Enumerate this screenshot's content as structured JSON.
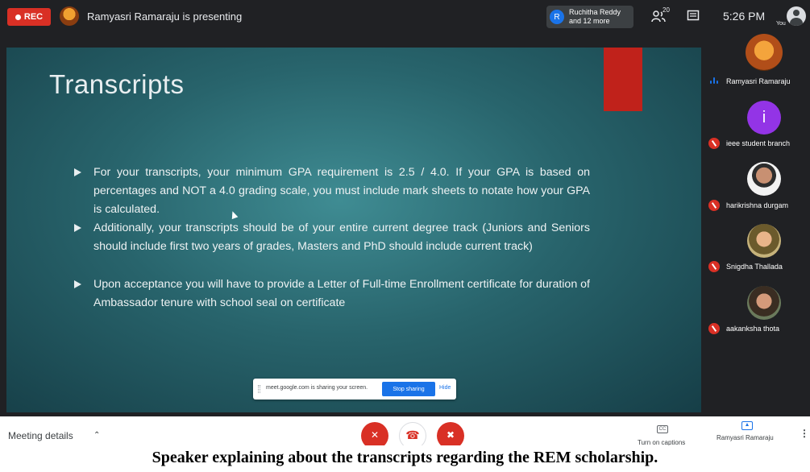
{
  "topbar": {
    "rec_label": "REC",
    "presenting_text": "Ramyasri Ramaraju is presenting",
    "chip_initial": "R",
    "chip_name": "Ruchitha Reddy",
    "chip_more": "and 12 more",
    "people_count": "20",
    "time": "5:26 PM",
    "you_label": "You"
  },
  "slide": {
    "title": "Transcripts",
    "bullets": [
      "For your transcripts, your minimum GPA requirement is 2.5 / 4.0. If your GPA is based on percentages and NOT a 4.0 grading scale, you must include mark sheets to notate how your GPA is calculated.",
      "Additionally, your transcripts should be of your entire current degree track (Juniors and Seniors should include first two years of grades, Masters and PhD should include current track)",
      "Upon acceptance you will have to provide a Letter of Full-time Enrollment certificate for duration of Ambassador tenure with school seal on certificate"
    ],
    "accent_color": "#c0221b"
  },
  "share_banner": {
    "text": "meet.google.com is sharing your screen.",
    "stop_label": "Stop sharing",
    "hide_label": "Hide"
  },
  "participants": [
    {
      "name": "Ramyasri Ramaraju",
      "state": "speaking"
    },
    {
      "name": "ieee student branch",
      "initial": "i",
      "state": "muted"
    },
    {
      "name": "harikrishna durgam",
      "state": "muted"
    },
    {
      "name": "Snigdha Thallada",
      "state": "muted"
    },
    {
      "name": "aakanksha thota",
      "state": "muted"
    }
  ],
  "bottombar": {
    "meeting_details": "Meeting details",
    "captions_label": "Turn on captions",
    "cc_glyph": "CC",
    "present_label": "Ramyasri Ramaraju"
  },
  "caption": "Speaker explaining about the transcripts regarding the REM scholarship."
}
